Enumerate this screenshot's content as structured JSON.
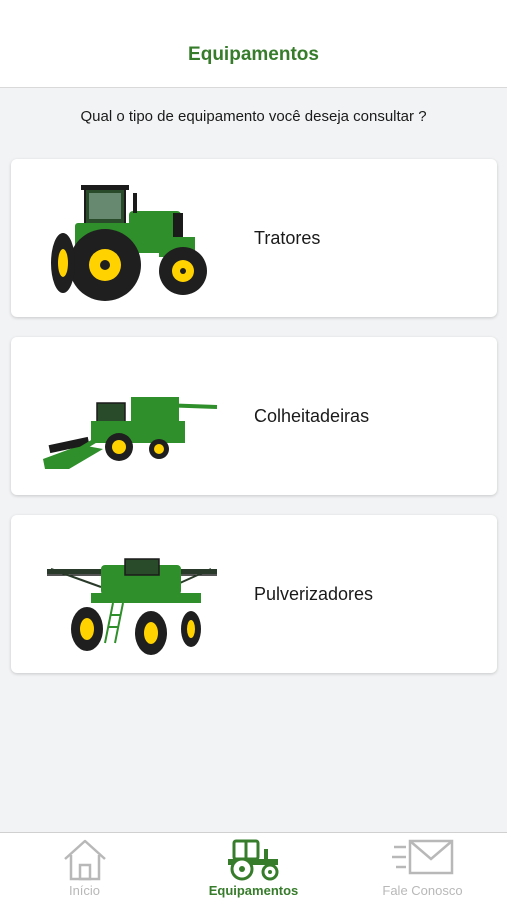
{
  "header": {
    "title": "Equipamentos"
  },
  "question": "Qual o tipo de equipamento você deseja consultar ?",
  "cards": [
    {
      "label": "Tratores",
      "icon": "tractor-image"
    },
    {
      "label": "Colheitadeiras",
      "icon": "combine-harvester-image"
    },
    {
      "label": "Pulverizadores",
      "icon": "sprayer-image"
    }
  ],
  "tabs": [
    {
      "label": "Início",
      "icon": "home-icon",
      "active": false
    },
    {
      "label": "Equipamentos",
      "icon": "tractor-icon",
      "active": true
    },
    {
      "label": "Fale Conosco",
      "icon": "mail-icon",
      "active": false
    }
  ],
  "colors": {
    "brand_green": "#367c2b",
    "machine_green": "#2f8f2a",
    "machine_yellow": "#ffd200",
    "inactive_gray": "#b8b8b8"
  }
}
